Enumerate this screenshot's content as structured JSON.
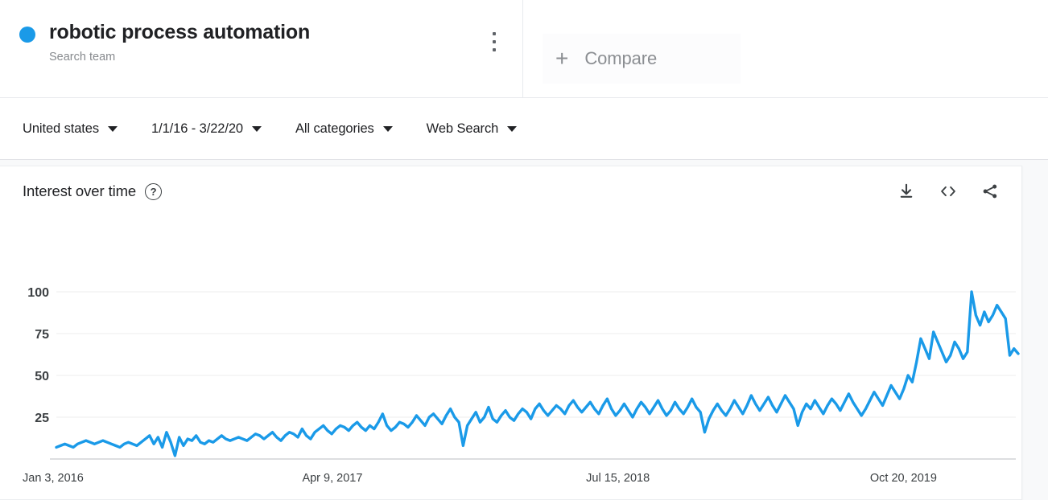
{
  "topbar": {
    "term": {
      "title": "robotic process automation",
      "subtitle": "Search team",
      "dot_color": "#1a9ae8",
      "menu_icon": "more-vert-icon"
    },
    "compare": {
      "plus": "+",
      "label": "Compare"
    }
  },
  "filters": [
    {
      "label": "United states",
      "caret": "chevron-down-icon"
    },
    {
      "label": "1/1/16 - 3/22/20",
      "caret": "chevron-down-icon"
    },
    {
      "label": "All categories",
      "caret": "chevron-down-icon"
    },
    {
      "label": "Web Search",
      "caret": "chevron-down-icon"
    }
  ],
  "card": {
    "title": "Interest over time",
    "help": "?",
    "actions": [
      {
        "name": "download-icon",
        "tooltip": "Download"
      },
      {
        "name": "embed-code-icon",
        "tooltip": "Embed"
      },
      {
        "name": "share-icon",
        "tooltip": "Share"
      }
    ]
  },
  "chart_data": {
    "type": "line",
    "title": "Interest over time",
    "xlabel": "",
    "ylabel": "",
    "ylim": [
      0,
      100
    ],
    "yticks": [
      25,
      50,
      75,
      100
    ],
    "grid": true,
    "legend": "none",
    "line_color": "#1a9ae8",
    "xtick_labels": [
      "Jan 3, 2016",
      "Apr 9, 2017",
      "Jul 15, 2018",
      "Oct 20, 2019"
    ],
    "xtick_positions": [
      0,
      66,
      133,
      200
    ],
    "x_count": 221,
    "series": [
      {
        "name": "robotic process automation",
        "values": [
          7,
          8,
          9,
          8,
          7,
          9,
          10,
          11,
          10,
          9,
          10,
          11,
          10,
          9,
          8,
          7,
          9,
          10,
          9,
          8,
          10,
          12,
          14,
          9,
          13,
          7,
          16,
          10,
          2,
          13,
          8,
          12,
          11,
          14,
          10,
          9,
          11,
          10,
          12,
          14,
          12,
          11,
          12,
          13,
          12,
          11,
          13,
          15,
          14,
          12,
          14,
          16,
          13,
          11,
          14,
          16,
          15,
          13,
          18,
          14,
          12,
          16,
          18,
          20,
          17,
          15,
          18,
          20,
          19,
          17,
          20,
          22,
          19,
          17,
          20,
          18,
          22,
          27,
          20,
          17,
          19,
          22,
          21,
          19,
          22,
          26,
          23,
          20,
          25,
          27,
          24,
          21,
          26,
          30,
          25,
          22,
          8,
          20,
          24,
          28,
          22,
          25,
          31,
          24,
          22,
          26,
          29,
          25,
          23,
          27,
          30,
          28,
          24,
          30,
          33,
          29,
          26,
          29,
          32,
          30,
          27,
          32,
          35,
          31,
          28,
          31,
          34,
          30,
          27,
          32,
          36,
          30,
          26,
          29,
          33,
          29,
          25,
          30,
          34,
          31,
          27,
          31,
          35,
          30,
          26,
          29,
          34,
          30,
          27,
          31,
          36,
          31,
          28,
          16,
          24,
          29,
          33,
          29,
          26,
          30,
          35,
          31,
          27,
          32,
          38,
          33,
          29,
          33,
          37,
          32,
          28,
          33,
          38,
          34,
          30,
          20,
          28,
          33,
          30,
          35,
          31,
          27,
          32,
          36,
          33,
          29,
          34,
          39,
          34,
          30,
          26,
          30,
          35,
          40,
          36,
          32,
          38,
          44,
          40,
          36,
          42,
          50,
          46,
          58,
          72,
          66,
          60,
          76,
          70,
          64,
          58,
          62,
          70,
          66,
          60,
          64,
          100,
          86,
          80,
          88,
          82,
          86,
          92,
          88,
          84,
          62,
          66,
          63
        ]
      }
    ]
  }
}
